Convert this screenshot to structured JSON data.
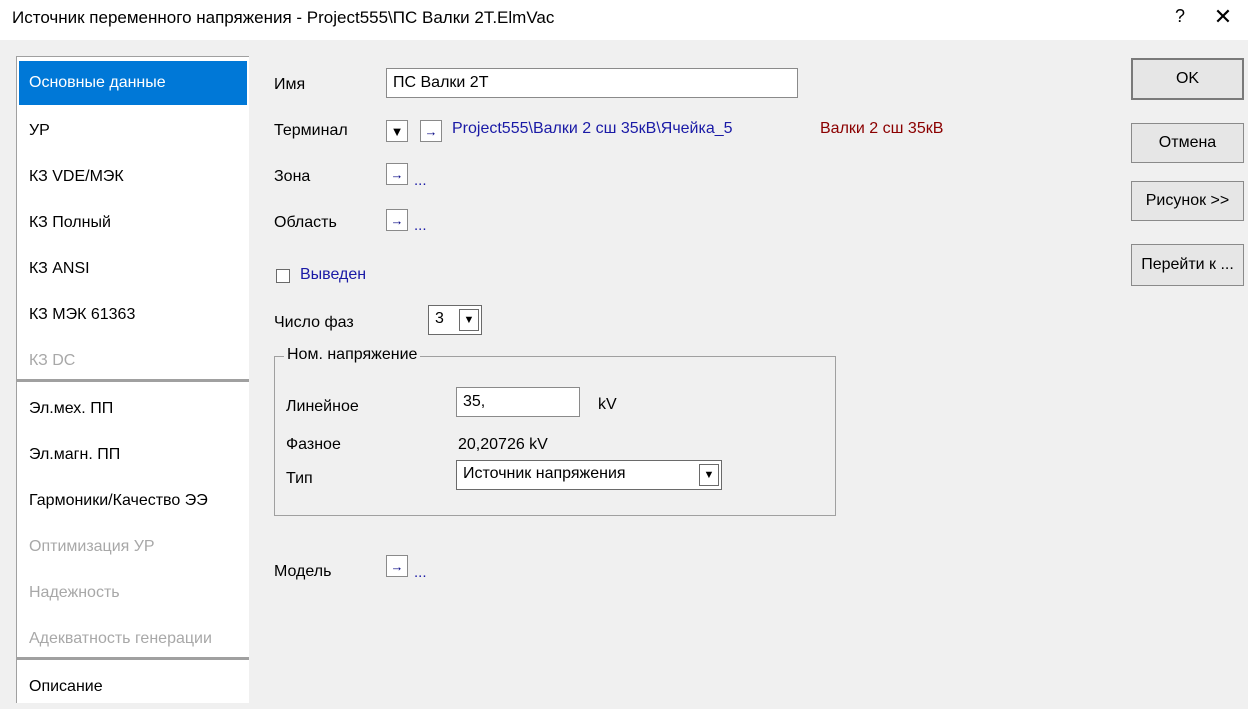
{
  "window": {
    "title": "Источник переменного напряжения - Project555\\ПС Валки 2Т.ElmVac",
    "help_label": "?",
    "close_label": "✕"
  },
  "nav": {
    "items": [
      {
        "label": "Основные данные",
        "state": "selected"
      },
      {
        "label": "УР",
        "state": "normal"
      },
      {
        "label": "КЗ VDE/МЭК",
        "state": "normal"
      },
      {
        "label": "КЗ Полный",
        "state": "normal"
      },
      {
        "label": "КЗ ANSI",
        "state": "normal"
      },
      {
        "label": "КЗ МЭК 61363",
        "state": "normal"
      },
      {
        "label": "КЗ DC",
        "state": "disabled"
      },
      {
        "label": "Эл.мех. ПП",
        "state": "normal"
      },
      {
        "label": "Эл.магн. ПП",
        "state": "normal"
      },
      {
        "label": "Гармоники/Качество ЭЭ",
        "state": "normal"
      },
      {
        "label": "Оптимизация УР",
        "state": "disabled"
      },
      {
        "label": "Надежность",
        "state": "disabled"
      },
      {
        "label": "Адекватность генерации",
        "state": "disabled"
      },
      {
        "label": "Описание",
        "state": "normal"
      }
    ]
  },
  "form": {
    "name_label": "Имя",
    "name_value": "ПС Валки 2Т",
    "terminal_label": "Терминал",
    "terminal_path": "Project555\\Валки 2 сш 35кВ\\Ячейка_5",
    "terminal_bus": "Валки 2 сш 35кВ",
    "zone_label": "Зона",
    "zone_value": "...",
    "area_label": "Область",
    "area_value": "...",
    "out_of_service_label": "Выведен",
    "out_of_service_checked": false,
    "phases_label": "Число фаз",
    "phases_value": "3",
    "nominal_group_title": "Ном. напряжение",
    "line_label": "Линейное",
    "line_value": "35,",
    "line_unit": "kV",
    "phase_label": "Фазное",
    "phase_value": "20,20726 kV",
    "type_label": "Тип",
    "type_value": "Источник напряжения",
    "model_label": "Модель",
    "model_value": "..."
  },
  "buttons": {
    "ok": "OK",
    "cancel": "Отмена",
    "picture": "Рисунок >>",
    "goto": "Перейти к ..."
  },
  "icons": {
    "jump": "→",
    "dropdown": "▼"
  },
  "colors": {
    "selection": "#0078d7",
    "link": "#1a1aa6",
    "bus": "#8b0000",
    "disabled": "#a8a8a8"
  }
}
